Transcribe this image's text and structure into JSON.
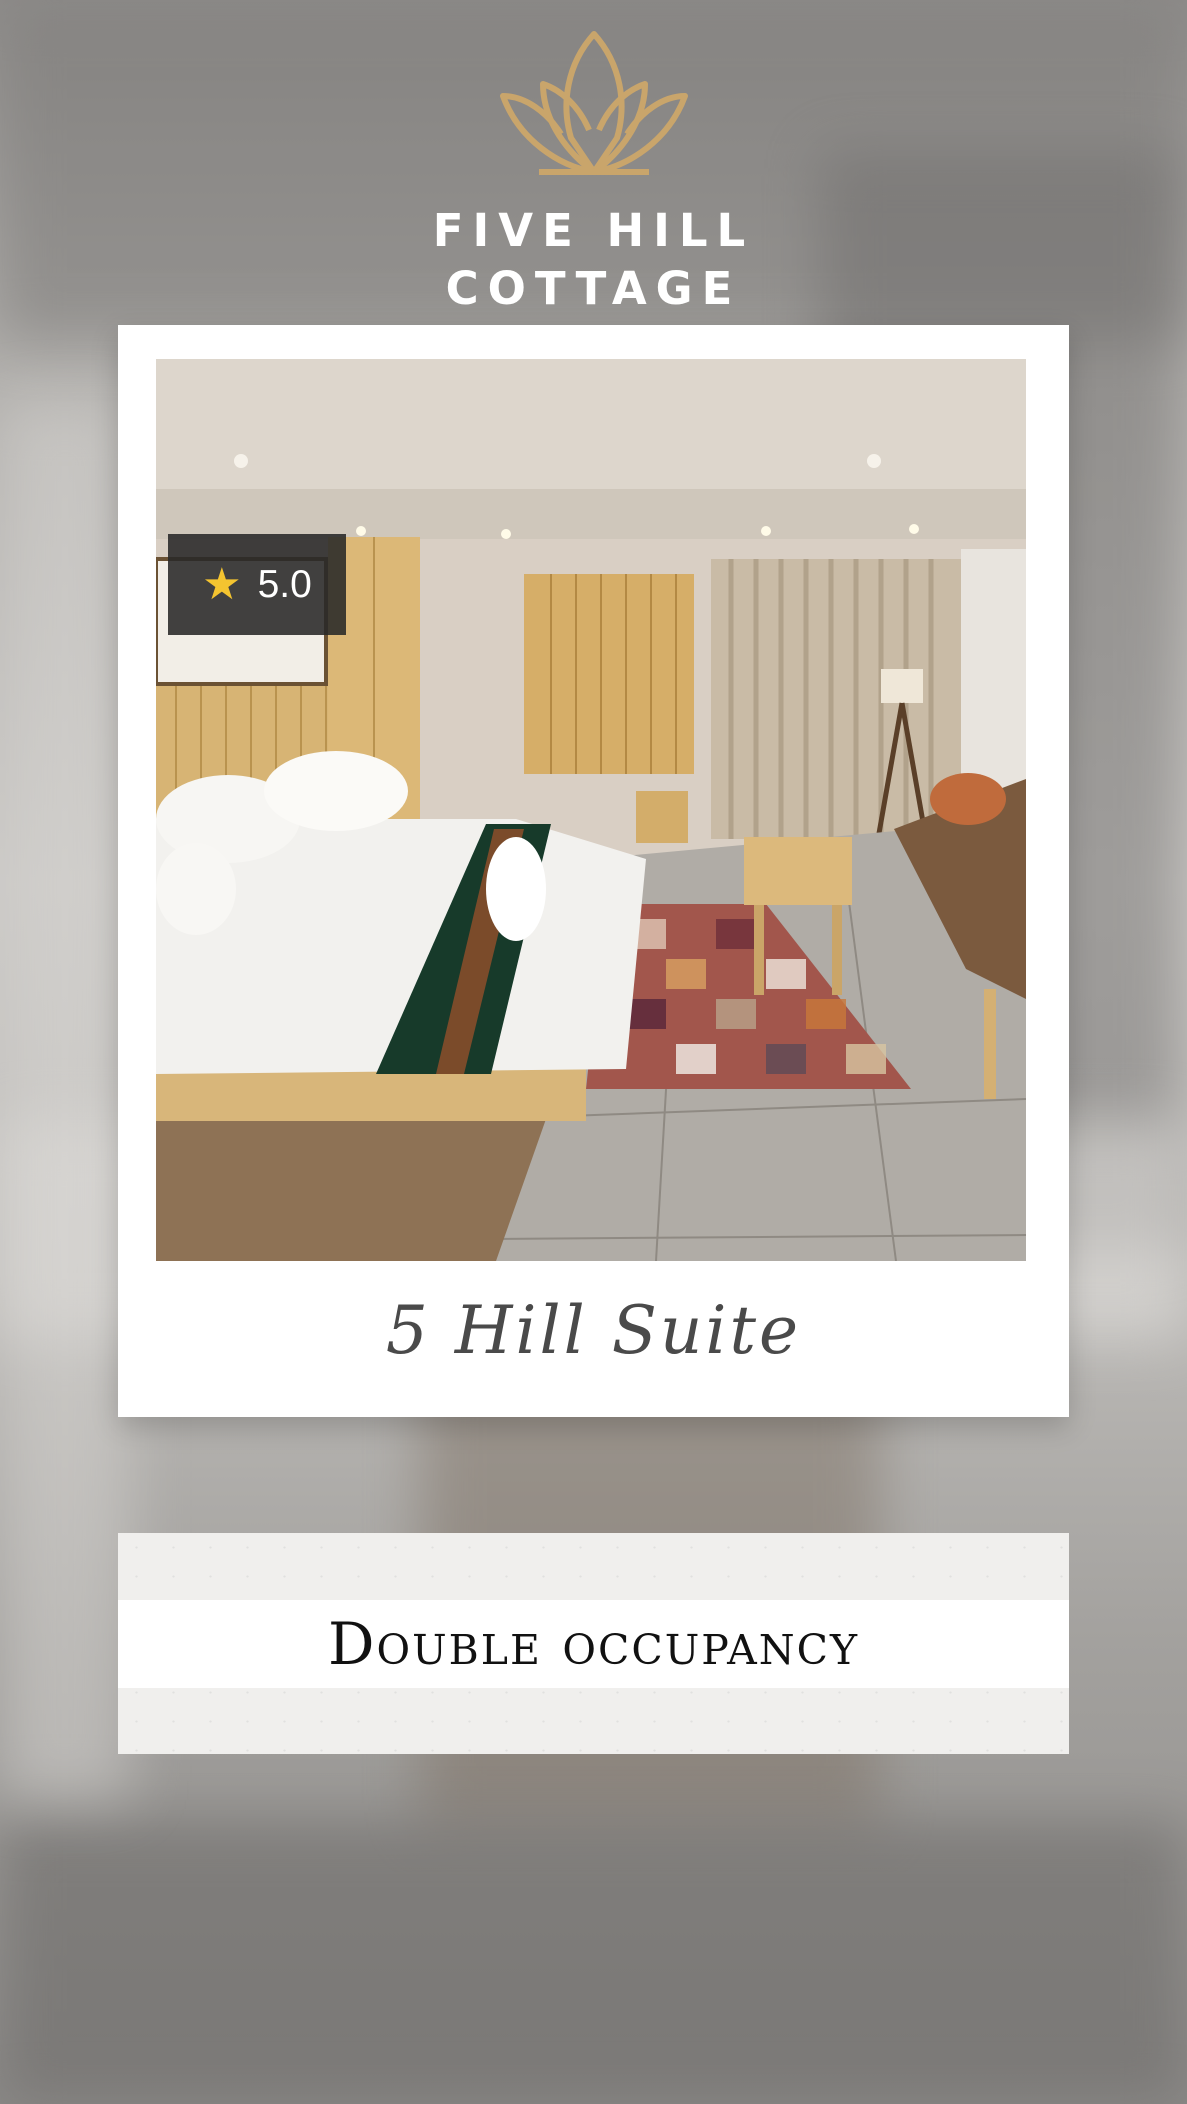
{
  "brand": {
    "line1": "FIVE HILL",
    "line2": "COTTAGE",
    "logo_icon": "lotus-icon",
    "logo_color": "#c9a56b"
  },
  "card": {
    "rating": {
      "icon": "star-icon",
      "value": "5.0",
      "star_color": "#f4c430"
    },
    "caption": "5 Hill Suite"
  },
  "banner": {
    "text": "Double occupancy"
  }
}
